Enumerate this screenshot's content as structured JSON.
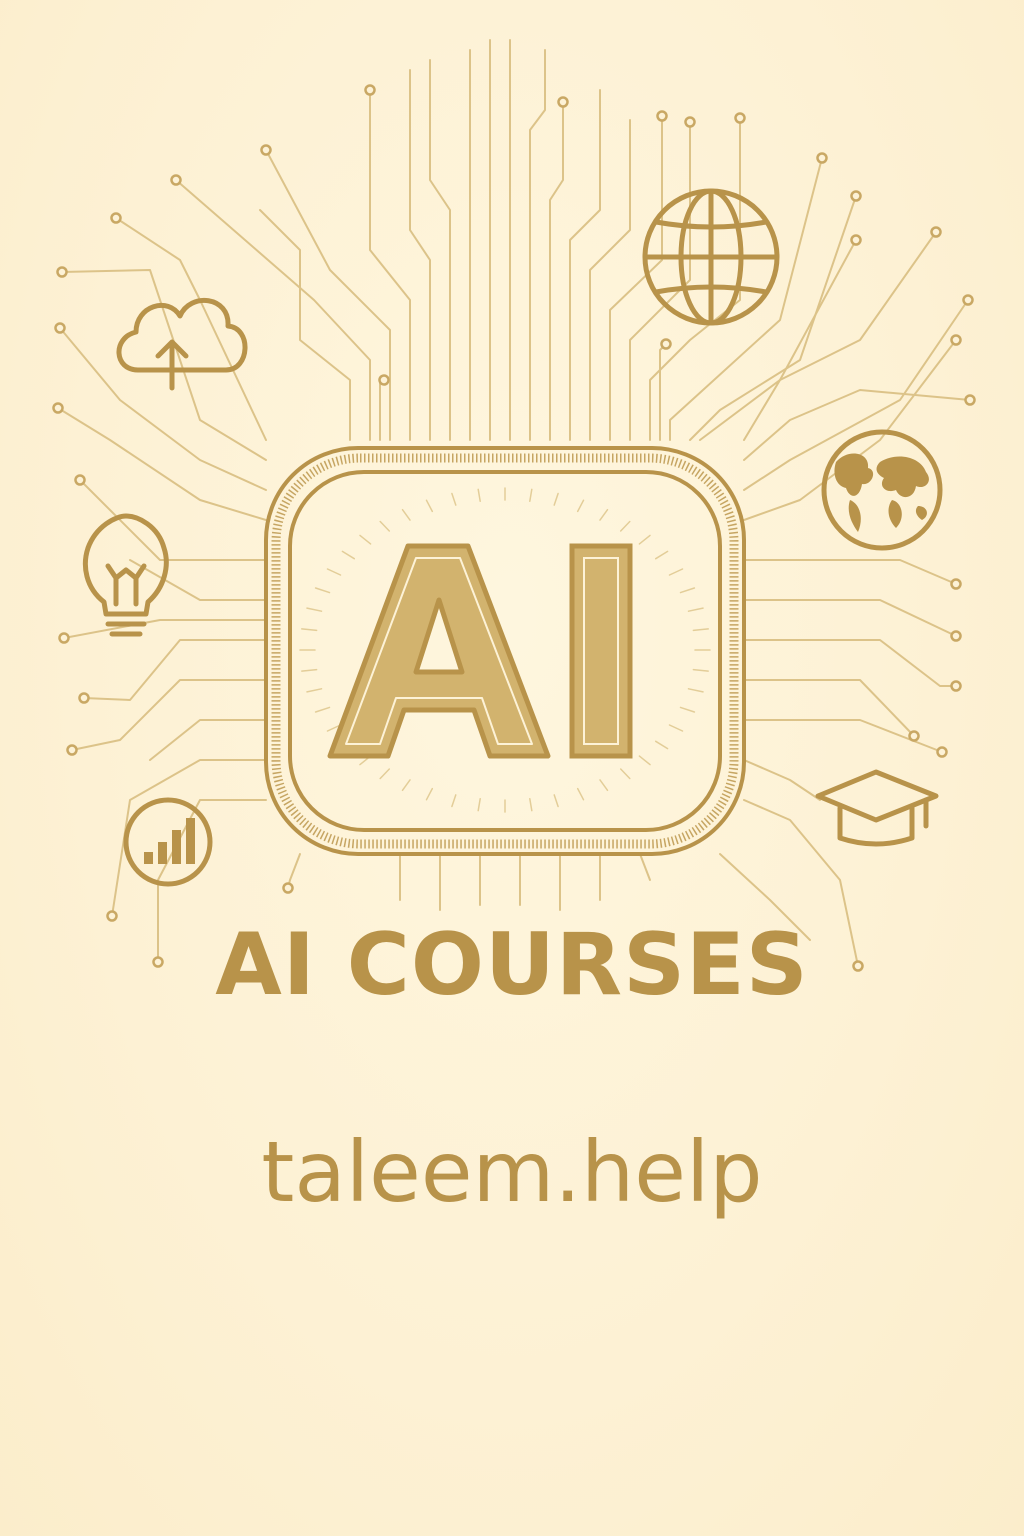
{
  "badge": {
    "text": "AI"
  },
  "headline": "AI COURSES",
  "website": "taleem.help",
  "colors": {
    "background": "#fdf2d6",
    "gold": "#b8934a",
    "gold_fill": "#d2b36e",
    "circuit": "#dcc389"
  },
  "icons": [
    "cloud-upload-icon",
    "globe-grid-icon",
    "world-map-icon",
    "lightbulb-icon",
    "bar-chart-icon",
    "graduation-cap-icon"
  ]
}
